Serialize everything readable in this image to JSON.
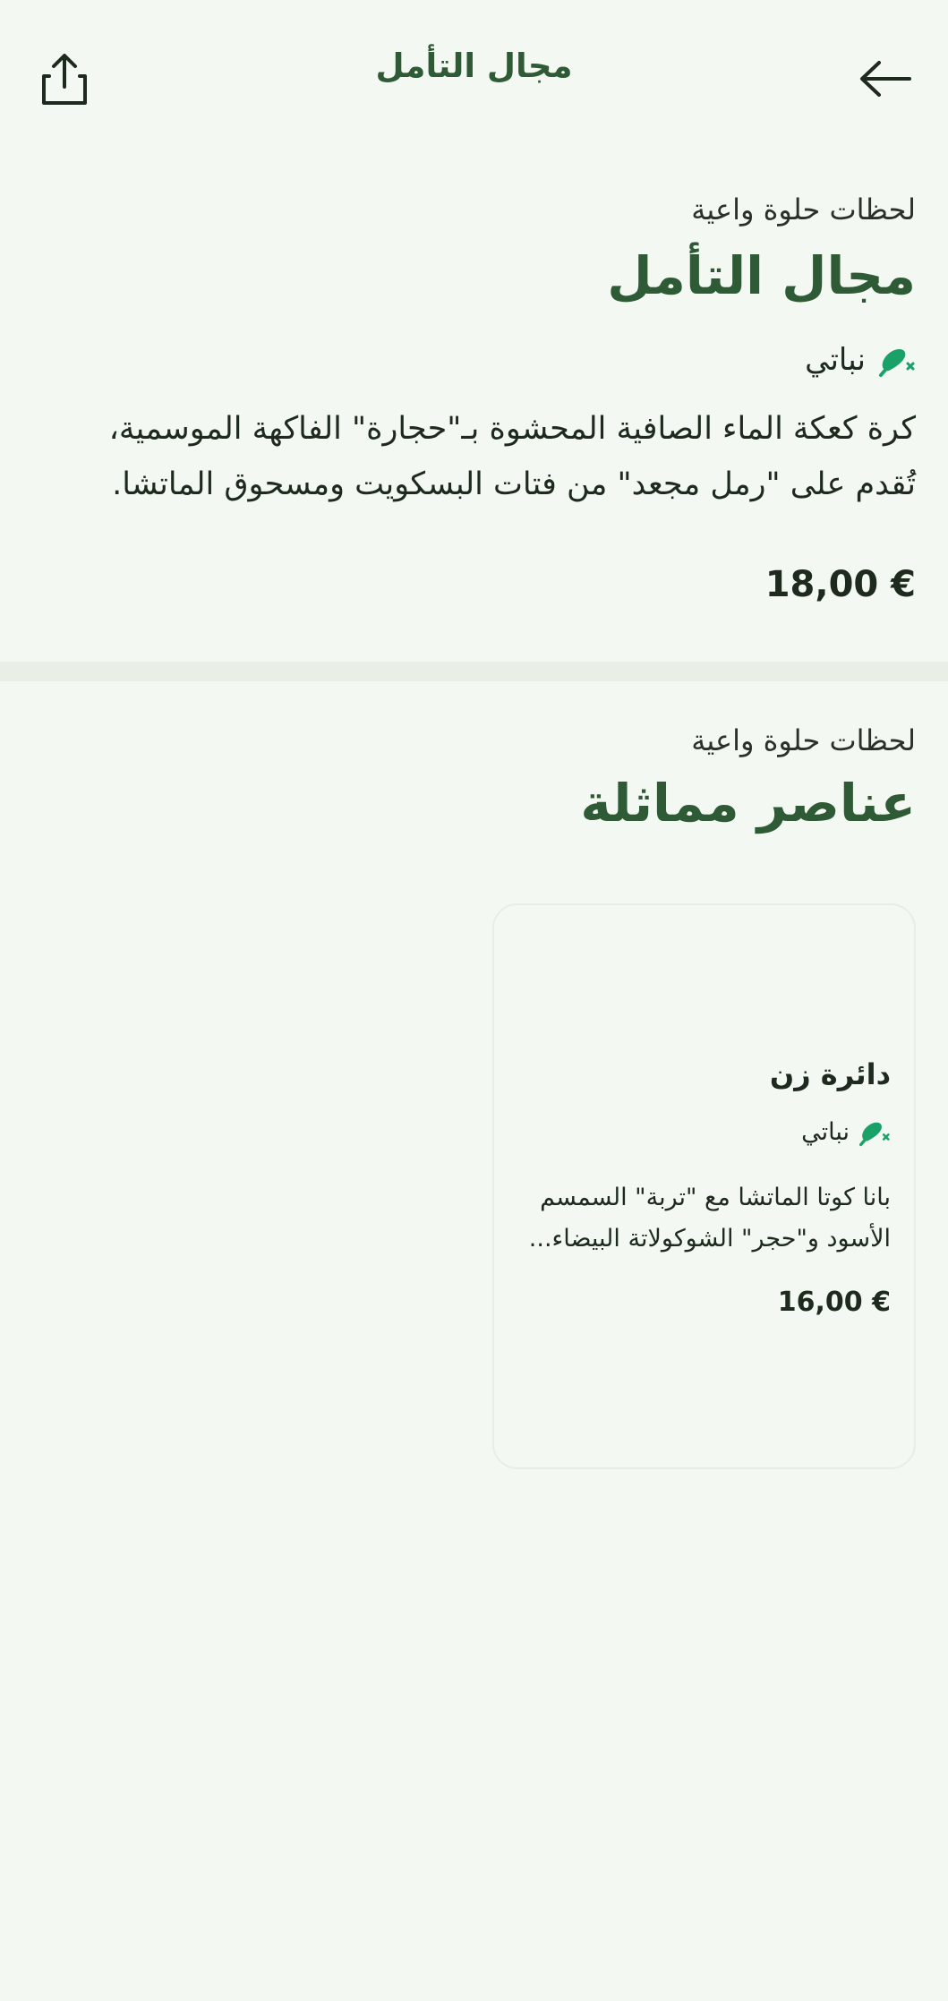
{
  "header": {
    "title": "مجال التأمل",
    "share_icon": "share-icon",
    "back_icon": "arrow-right-icon"
  },
  "item": {
    "category": "لحظات حلوة واعية",
    "name": "مجال التأمل",
    "diet": "نباتي",
    "diet_icon": "no-meat-icon",
    "description": "كرة كعكة الماء الصافية المحشوة بـ\"حجارة\" الفاكهة الموسمية، تُقدم على \"رمل مجعد\" من فتات البسكويت ومسحوق الماتشا.",
    "price": "18,00 €"
  },
  "similar": {
    "category": "لحظات حلوة واعية",
    "title": "عناصر مماثلة",
    "items": [
      {
        "name": "دائرة زن",
        "diet": "نباتي",
        "description": "بانا كوتا الماتشا مع \"تربة\" السمسم الأسود و\"حجر\" الشوكولاتة البيضاء...",
        "price": "16,00 €"
      }
    ]
  },
  "colors": {
    "background": "#f4f8f2",
    "brand_green": "#2f5a36",
    "icon_green": "#1aa168",
    "divider": "#e9efe7"
  }
}
